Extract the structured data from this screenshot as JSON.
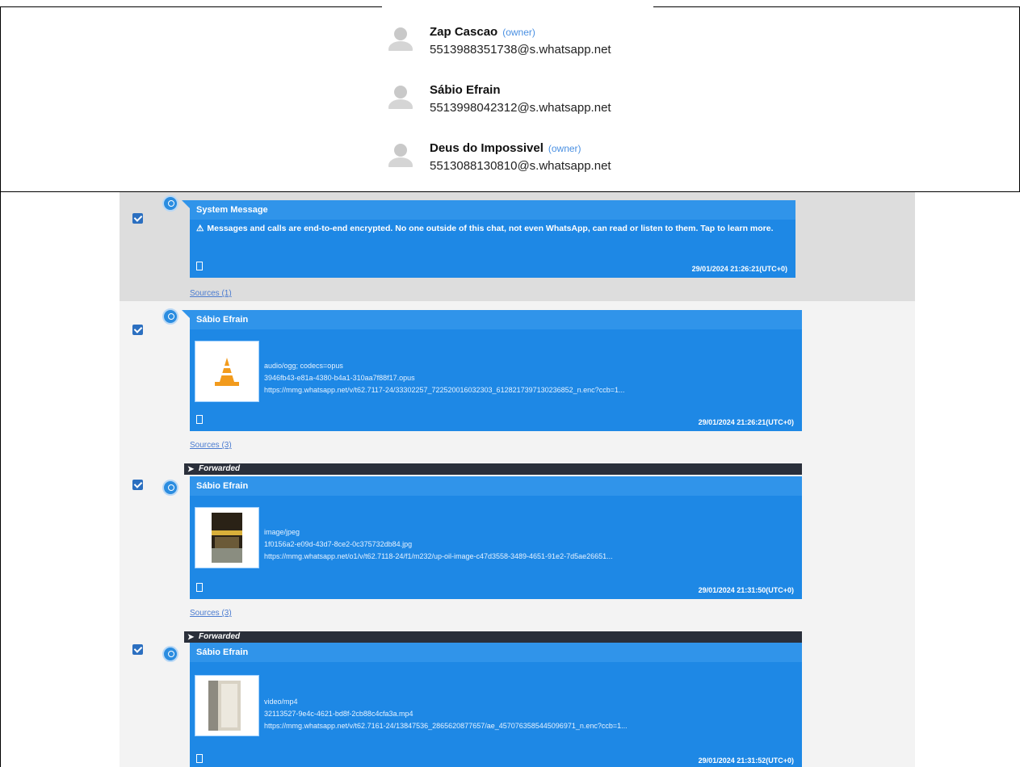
{
  "participants": [
    {
      "name": "Zap Cascao",
      "role": "(owner)",
      "id": "5513988351738@s.whatsapp.net"
    },
    {
      "name": "Sábio Efrain",
      "role": "",
      "id": "5513998042312@s.whatsapp.net"
    },
    {
      "name": "Deus do Impossivel",
      "role": "(owner)",
      "id": "5513088130810@s.whatsapp.net"
    }
  ],
  "messages": [
    {
      "sender": "System Message",
      "text": "Messages and calls are end-to-end encrypted. No one outside of this chat, not even WhatsApp, can read or listen to them. Tap to learn more.",
      "timestamp": "29/01/2024 21:26:21(UTC+0)",
      "sources": "Sources (1)"
    },
    {
      "sender": "Sábio Efrain",
      "mime": "audio/ogg; codecs=opus",
      "filename": "3946fb43-e81a-4380-b4a1-310aa7f88f17.opus",
      "url": "https://mmg.whatsapp.net/v/t62.7117-24/33302257_722520016032303_6128217397130236852_n.enc?ccb=1...",
      "timestamp": "29/01/2024 21:26:21(UTC+0)",
      "sources": "Sources (3)"
    },
    {
      "forwarded": "Forwarded",
      "sender": "Sábio Efrain",
      "mime": "image/jpeg",
      "filename": "1f0156a2-e09d-43d7-8ce2-0c375732db84.jpg",
      "url": "https://mmg.whatsapp.net/o1/v/t62.7118-24/f1/m232/up-oil-image-c47d3558-3489-4651-91e2-7d5ae26651...",
      "timestamp": "29/01/2024 21:31:50(UTC+0)",
      "sources": "Sources (3)"
    },
    {
      "forwarded": "Forwarded",
      "sender": "Sábio Efrain",
      "mime": "video/mp4",
      "filename": "32113527-9e4c-4621-bd8f-2cb88c4cfa3a.mp4",
      "url": "https://mmg.whatsapp.net/v/t62.7161-24/13847536_2865620877657/ae_4570763585445096971_n.enc?ccb=1...",
      "timestamp": "29/01/2024 21:31:52(UTC+0)"
    }
  ]
}
